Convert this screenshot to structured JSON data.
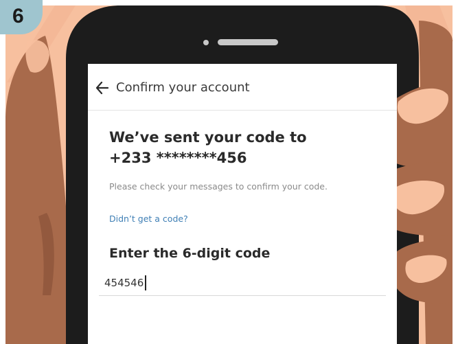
{
  "step_badge": {
    "number": "6"
  },
  "header": {
    "title": "Confirm your account",
    "back_icon": "arrow-left-icon"
  },
  "message": {
    "headline_line1": "We’ve sent your code to",
    "headline_line2": "+233 ********456",
    "helper": "Please check your messages to confirm your code."
  },
  "resend_link": {
    "label": "Didn’t get a code?"
  },
  "code_entry": {
    "label": "Enter the 6-digit code",
    "value": "454546"
  },
  "colors": {
    "skin": "#f7c09f",
    "skin_dark": "#a86a4b",
    "phone_body": "#1c1c1c",
    "badge": "#9fc5cf",
    "link": "#3f7fb5"
  }
}
